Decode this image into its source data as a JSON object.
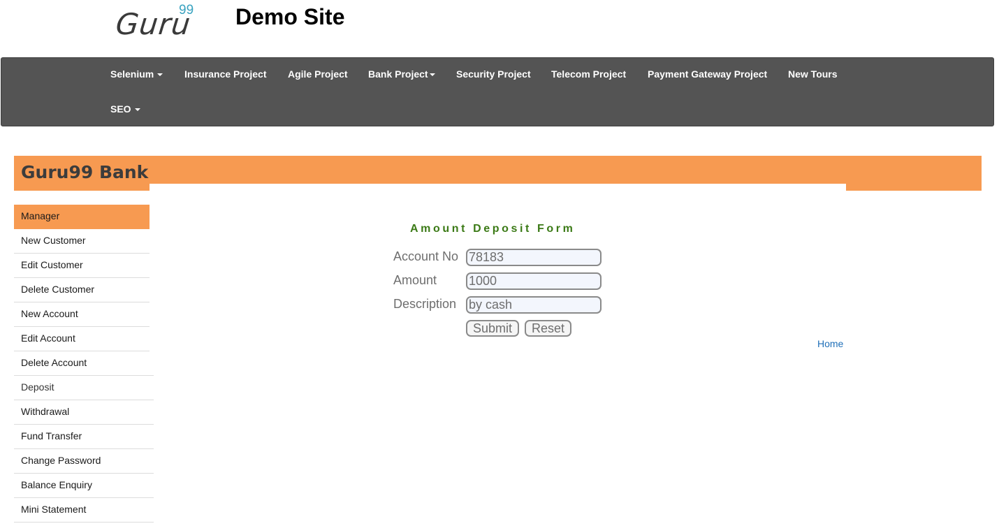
{
  "header": {
    "logo_text": "Guru",
    "logo_sup": "99",
    "site_title": "Demo Site"
  },
  "navbar": {
    "items": [
      {
        "label": "Selenium",
        "dropdown": true
      },
      {
        "label": "Insurance Project",
        "dropdown": false
      },
      {
        "label": "Agile Project",
        "dropdown": false
      },
      {
        "label": "Bank Project",
        "dropdown": true
      },
      {
        "label": "Security Project",
        "dropdown": false
      },
      {
        "label": "Telecom Project",
        "dropdown": false
      },
      {
        "label": "Payment Gateway Project",
        "dropdown": false
      },
      {
        "label": "New Tours",
        "dropdown": false
      },
      {
        "label": "SEO",
        "dropdown": true
      }
    ]
  },
  "bank": {
    "title": "Guru99 Bank"
  },
  "sidebar": {
    "items": [
      {
        "label": "Manager"
      },
      {
        "label": "New Customer"
      },
      {
        "label": "Edit Customer"
      },
      {
        "label": "Delete Customer"
      },
      {
        "label": "New Account"
      },
      {
        "label": "Edit Account"
      },
      {
        "label": "Delete Account"
      },
      {
        "label": "Deposit"
      },
      {
        "label": "Withdrawal"
      },
      {
        "label": "Fund Transfer"
      },
      {
        "label": "Change Password"
      },
      {
        "label": "Balance Enquiry"
      },
      {
        "label": "Mini Statement"
      }
    ]
  },
  "form": {
    "title": "Amount Deposit Form",
    "account_no_label": "Account No",
    "account_no_value": "78183",
    "amount_label": "Amount",
    "amount_value": "1000",
    "description_label": "Description",
    "description_value": "by cash",
    "submit_label": "Submit",
    "reset_label": "Reset"
  },
  "footer": {
    "home_link": "Home"
  },
  "colors": {
    "navbar_bg": "#545454",
    "accent_orange": "#f79a51",
    "form_title_green": "#3b7a16",
    "link_blue": "#1f6fb8",
    "logo_sup_teal": "#3aa3c0"
  }
}
